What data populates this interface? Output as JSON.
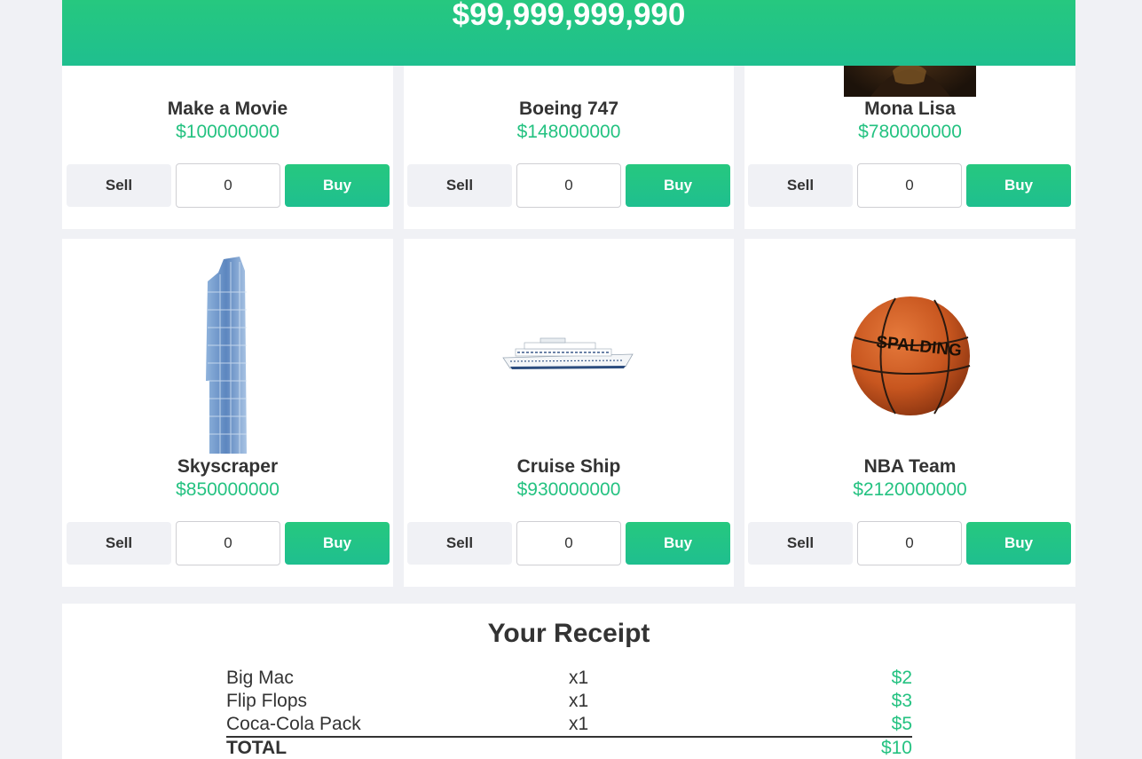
{
  "header": {
    "money": "$99,999,999,990"
  },
  "products": [
    {
      "name": "Make a Movie",
      "price": "$100000000",
      "sell_label": "Sell",
      "buy_label": "Buy",
      "quantity": "0"
    },
    {
      "name": "Boeing 747",
      "price": "$148000000",
      "sell_label": "Sell",
      "buy_label": "Buy",
      "quantity": "0"
    },
    {
      "name": "Mona Lisa",
      "price": "$780000000",
      "sell_label": "Sell",
      "buy_label": "Buy",
      "quantity": "0",
      "image": "mona-lisa-painting"
    },
    {
      "name": "Skyscraper",
      "price": "$850000000",
      "sell_label": "Sell",
      "buy_label": "Buy",
      "quantity": "0",
      "image": "skyscraper-building"
    },
    {
      "name": "Cruise Ship",
      "price": "$930000000",
      "sell_label": "Sell",
      "buy_label": "Buy",
      "quantity": "0",
      "image": "cruise-ship"
    },
    {
      "name": "NBA Team",
      "price": "$2120000000",
      "sell_label": "Sell",
      "buy_label": "Buy",
      "quantity": "0",
      "image": "spalding-basketball",
      "image_text": "SPALDING"
    }
  ],
  "receipt": {
    "title": "Your Receipt",
    "items": [
      {
        "name": "Big Mac",
        "qty": "x1",
        "amount": "$2"
      },
      {
        "name": "Flip Flops",
        "qty": "x1",
        "amount": "$3"
      },
      {
        "name": "Coca-Cola Pack",
        "qty": "x1",
        "amount": "$5"
      }
    ],
    "total_label": "TOTAL",
    "total_amount": "$10"
  },
  "colors": {
    "accent": "#24c281",
    "background": "#f0f1f5",
    "text": "#333333"
  }
}
